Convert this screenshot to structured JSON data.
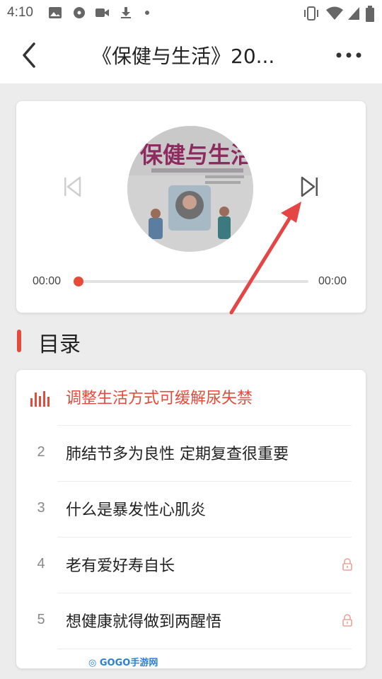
{
  "status_bar": {
    "time": "4:10"
  },
  "header": {
    "title": "《保健与生活》20..."
  },
  "player": {
    "time_current": "00:00",
    "time_total": "00:00",
    "progress": 0
  },
  "section": {
    "title": "目录"
  },
  "tracks": [
    {
      "num": "",
      "title": "调整生活方式可缓解尿失禁",
      "active": true,
      "locked": false
    },
    {
      "num": "2",
      "title": "肺结节多为良性 定期复查很重要",
      "active": false,
      "locked": false
    },
    {
      "num": "3",
      "title": "什么是暴发性心肌炎",
      "active": false,
      "locked": false
    },
    {
      "num": "4",
      "title": "老有爱好寿自长",
      "active": false,
      "locked": true
    },
    {
      "num": "5",
      "title": "想健康就得做到两醒悟",
      "active": false,
      "locked": true
    }
  ],
  "watermark": "GOGO手游网",
  "colors": {
    "accent": "#e64a3b",
    "background": "#ececec"
  }
}
